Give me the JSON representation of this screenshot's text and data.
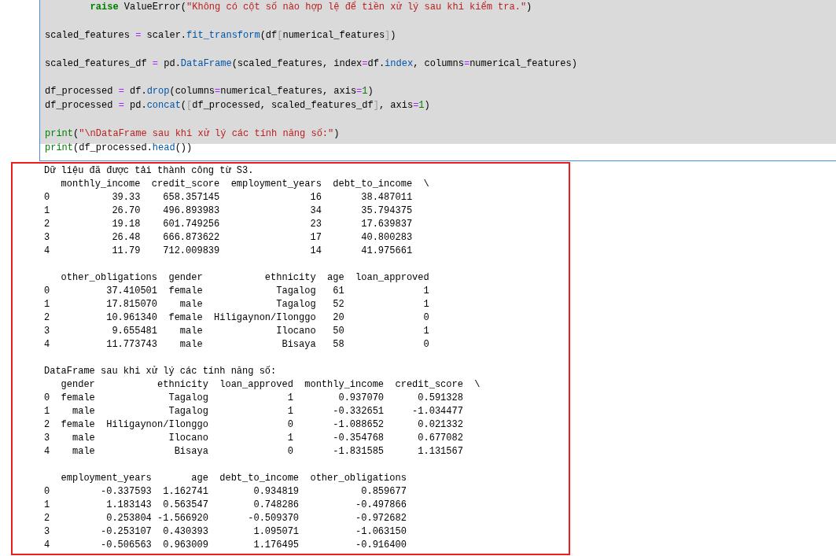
{
  "code_cell": {
    "lines": [
      {
        "kind": "code_indented",
        "tokens": [
          {
            "kind": "kw",
            "text": "raise"
          },
          {
            "kind": "plain",
            "text": " ValueError("
          },
          {
            "kind": "str",
            "text": "\"Không có cột số nào hợp lệ để tiền xử lý sau khi kiểm tra.\""
          },
          {
            "kind": "plain",
            "text": ")"
          }
        ]
      },
      {
        "kind": "blank"
      },
      {
        "kind": "code",
        "tokens": [
          {
            "kind": "plain",
            "text": "scaled_features "
          },
          {
            "kind": "op",
            "text": "="
          },
          {
            "kind": "plain",
            "text": " scaler."
          },
          {
            "kind": "attr",
            "text": "fit_transform"
          },
          {
            "kind": "plain",
            "text": "(df"
          },
          {
            "kind": "bracket",
            "text": "["
          },
          {
            "kind": "plain",
            "text": "numerical_features"
          },
          {
            "kind": "bracket",
            "text": "]"
          },
          {
            "kind": "plain",
            "text": ")"
          }
        ]
      },
      {
        "kind": "blank"
      },
      {
        "kind": "code",
        "tokens": [
          {
            "kind": "plain",
            "text": "scaled_features_df "
          },
          {
            "kind": "op",
            "text": "="
          },
          {
            "kind": "plain",
            "text": " pd."
          },
          {
            "kind": "attr",
            "text": "DataFrame"
          },
          {
            "kind": "plain",
            "text": "(scaled_features, index"
          },
          {
            "kind": "op",
            "text": "="
          },
          {
            "kind": "plain",
            "text": "df."
          },
          {
            "kind": "attr",
            "text": "index"
          },
          {
            "kind": "plain",
            "text": ", columns"
          },
          {
            "kind": "op",
            "text": "="
          },
          {
            "kind": "plain",
            "text": "numerical_features)"
          }
        ]
      },
      {
        "kind": "blank"
      },
      {
        "kind": "code",
        "tokens": [
          {
            "kind": "plain",
            "text": "df_processed "
          },
          {
            "kind": "op",
            "text": "="
          },
          {
            "kind": "plain",
            "text": " df."
          },
          {
            "kind": "attr",
            "text": "drop"
          },
          {
            "kind": "plain",
            "text": "(columns"
          },
          {
            "kind": "op",
            "text": "="
          },
          {
            "kind": "plain",
            "text": "numerical_features, axis"
          },
          {
            "kind": "op",
            "text": "="
          },
          {
            "kind": "num",
            "text": "1"
          },
          {
            "kind": "plain",
            "text": ")"
          }
        ]
      },
      {
        "kind": "code",
        "tokens": [
          {
            "kind": "plain",
            "text": "df_processed "
          },
          {
            "kind": "op",
            "text": "="
          },
          {
            "kind": "plain",
            "text": " pd."
          },
          {
            "kind": "attr",
            "text": "concat"
          },
          {
            "kind": "plain",
            "text": "("
          },
          {
            "kind": "bracket",
            "text": "["
          },
          {
            "kind": "plain",
            "text": "df_processed, scaled_features_df"
          },
          {
            "kind": "bracket",
            "text": "]"
          },
          {
            "kind": "plain",
            "text": ", axis"
          },
          {
            "kind": "op",
            "text": "="
          },
          {
            "kind": "num",
            "text": "1"
          },
          {
            "kind": "plain",
            "text": ")"
          }
        ]
      },
      {
        "kind": "blank"
      },
      {
        "kind": "code",
        "tokens": [
          {
            "kind": "builtin",
            "text": "print"
          },
          {
            "kind": "plain",
            "text": "("
          },
          {
            "kind": "str",
            "text": "\"\\nDataFrame sau khi xử lý các tính năng số:\""
          },
          {
            "kind": "plain",
            "text": ")"
          }
        ]
      },
      {
        "kind": "code",
        "tokens": [
          {
            "kind": "builtin",
            "text": "print"
          },
          {
            "kind": "plain",
            "text": "(df_processed."
          },
          {
            "kind": "attr",
            "text": "head"
          },
          {
            "kind": "plain",
            "text": "())"
          }
        ]
      }
    ]
  },
  "output": {
    "blocks": [
      [
        "Dữ liệu đã được tải thành công từ S3.",
        "   monthly_income  credit_score  employment_years  debt_to_income  \\",
        "0           39.33    658.357145                16       38.487011",
        "1           26.70    496.893983                34       35.794375",
        "2           19.18    601.749256                23       17.639837",
        "3           26.48    666.873622                17       40.800283",
        "4           11.79    712.009839                14       41.975661"
      ],
      [
        "   other_obligations  gender           ethnicity  age  loan_approved",
        "0          37.410501  female             Tagalog   61              1",
        "1          17.815070    male             Tagalog   52              1",
        "2          10.961340  female  Hiligaynon/Ilonggo   20              0",
        "3           9.655481    male             Ilocano   50              1",
        "4          11.773743    male              Bisaya   58              0"
      ],
      [
        "DataFrame sau khi xử lý các tính năng số:",
        "   gender           ethnicity  loan_approved  monthly_income  credit_score  \\",
        "0  female             Tagalog              1        0.937070      0.591328",
        "1    male             Tagalog              1       -0.332651     -1.034477",
        "2  female  Hiligaynon/Ilonggo              0       -1.088652      0.021332",
        "3    male             Ilocano              1       -0.354768      0.677082",
        "4    male              Bisaya              0       -1.831585      1.131567"
      ],
      [
        "   employment_years       age  debt_to_income  other_obligations",
        "0         -0.337593  1.162741        0.934819           0.859677",
        "1          1.183143  0.563547        0.748286          -0.497866",
        "2          0.253804 -1.566920       -0.509370          -0.972682",
        "3         -0.253107  0.430393        1.095071          -1.063150",
        "4         -0.506563  0.963009        1.176495          -0.916400"
      ]
    ]
  }
}
